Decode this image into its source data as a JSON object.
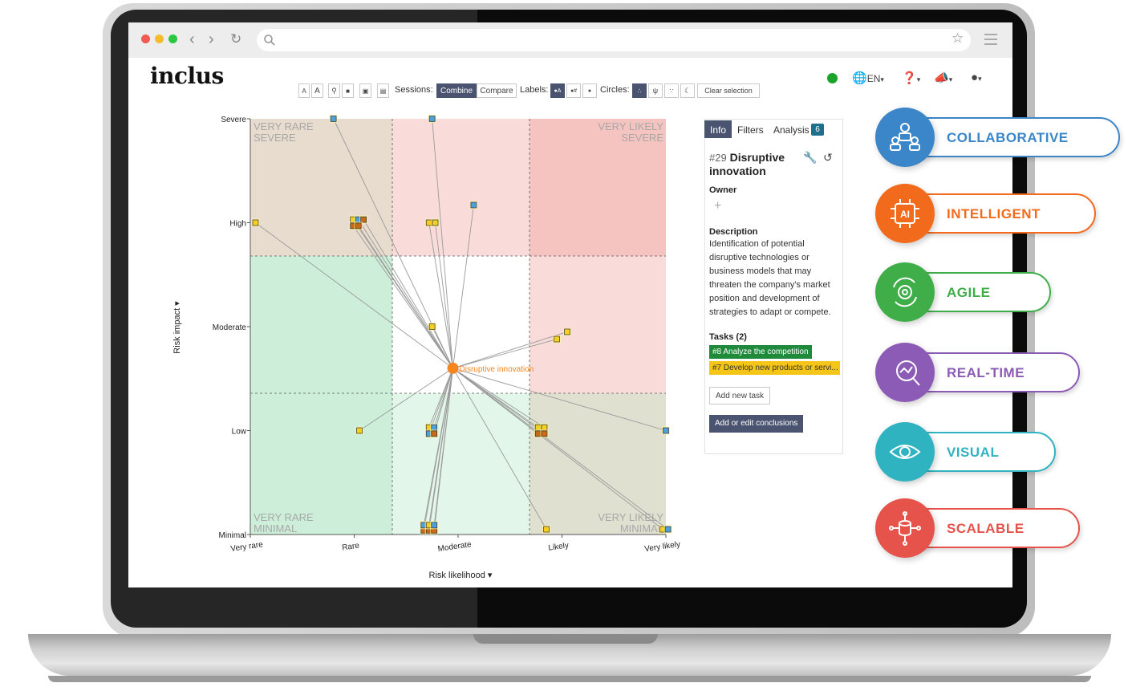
{
  "browser": {
    "url": ""
  },
  "app": {
    "logo": "inclus"
  },
  "toolbar": {
    "font_small": "A",
    "font_large": "A",
    "sessions_label": "Sessions:",
    "combine_label": "Combine",
    "compare_label": "Compare",
    "labels_label": "Labels:",
    "circles_label": "Circles:",
    "clear_selection_label": "Clear selection"
  },
  "header": {
    "language": "EN",
    "status_color": "#1aa32a"
  },
  "chart": {
    "quadrant_labels": {
      "top_left": [
        "VERY RARE",
        "SEVERE"
      ],
      "top_right": [
        "VERY LIKELY",
        "SEVERE"
      ],
      "bottom_left": [
        "VERY RARE",
        "MINIMAL"
      ],
      "bottom_right": [
        "VERY LIKELY",
        "MINIMAL"
      ]
    },
    "zone_colors": {
      "brown": "#e8dccf",
      "pink": "#f9dcd9",
      "red": "#f6c4c0",
      "white": "#ffffff",
      "green_dark": "#cdeed9",
      "green_light": "#e2f6e9",
      "olive": "#e0e0d1"
    },
    "center_label": "Disruptive innovation",
    "center_color": "#f5861f"
  },
  "chart_data": {
    "type": "scatter",
    "xlabel": "Risk likelihood",
    "ylabel": "Risk impact",
    "x_ticks": [
      "Very rare",
      "Rare",
      "Moderate",
      "Likely",
      "Very likely"
    ],
    "y_ticks": [
      "Minimal",
      "Low",
      "Moderate",
      "High",
      "Severe"
    ],
    "xlim": [
      1,
      5
    ],
    "ylim": [
      1,
      5
    ],
    "center": {
      "name": "Disruptive innovation",
      "x": 2.95,
      "y": 2.6
    },
    "points": [
      {
        "x": 1.8,
        "y": 5.0,
        "c": "#4f9fd8"
      },
      {
        "x": 2.75,
        "y": 5.0,
        "c": "#4f9fd8"
      },
      {
        "x": 1.05,
        "y": 4.0,
        "c": "#f5d020"
      },
      {
        "x": 1.99,
        "y": 4.03,
        "c": "#f5d020"
      },
      {
        "x": 2.04,
        "y": 4.03,
        "c": "#4f9fd8"
      },
      {
        "x": 2.09,
        "y": 4.03,
        "c": "#c86a14"
      },
      {
        "x": 1.99,
        "y": 3.97,
        "c": "#c86a14"
      },
      {
        "x": 2.04,
        "y": 3.97,
        "c": "#c86a14"
      },
      {
        "x": 2.72,
        "y": 4.0,
        "c": "#f5d020"
      },
      {
        "x": 2.78,
        "y": 4.0,
        "c": "#f5d020"
      },
      {
        "x": 3.15,
        "y": 4.17,
        "c": "#4f9fd8"
      },
      {
        "x": 3.95,
        "y": 2.88,
        "c": "#f5d020"
      },
      {
        "x": 4.05,
        "y": 2.95,
        "c": "#f5d020"
      },
      {
        "x": 2.75,
        "y": 3.0,
        "c": "#f5d020"
      },
      {
        "x": 2.05,
        "y": 2.0,
        "c": "#f5d020"
      },
      {
        "x": 2.72,
        "y": 2.03,
        "c": "#f5d020"
      },
      {
        "x": 2.77,
        "y": 2.03,
        "c": "#4f9fd8"
      },
      {
        "x": 2.72,
        "y": 1.97,
        "c": "#4f9fd8"
      },
      {
        "x": 2.77,
        "y": 1.97,
        "c": "#c86a14"
      },
      {
        "x": 3.77,
        "y": 2.03,
        "c": "#f5d020"
      },
      {
        "x": 3.83,
        "y": 2.03,
        "c": "#f5d020"
      },
      {
        "x": 3.77,
        "y": 1.97,
        "c": "#c86a14"
      },
      {
        "x": 3.83,
        "y": 1.97,
        "c": "#c86a14"
      },
      {
        "x": 5.0,
        "y": 2.0,
        "c": "#4f9fd8"
      },
      {
        "x": 2.67,
        "y": 1.04,
        "c": "#c86a14"
      },
      {
        "x": 2.72,
        "y": 1.04,
        "c": "#c86a14"
      },
      {
        "x": 2.77,
        "y": 1.04,
        "c": "#c86a14"
      },
      {
        "x": 2.67,
        "y": 1.09,
        "c": "#4f9fd8"
      },
      {
        "x": 2.72,
        "y": 1.09,
        "c": "#f5d020"
      },
      {
        "x": 2.77,
        "y": 1.09,
        "c": "#4f9fd8"
      },
      {
        "x": 3.85,
        "y": 1.05,
        "c": "#f5d020"
      },
      {
        "x": 4.97,
        "y": 1.05,
        "c": "#f5d020"
      },
      {
        "x": 5.02,
        "y": 1.05,
        "c": "#4f9fd8"
      }
    ]
  },
  "panel": {
    "tabs": {
      "info": "Info",
      "filters": "Filters",
      "analysis": "Analysis",
      "analysis_count": "6"
    },
    "risk_id": "#29",
    "risk_title": "Disruptive innovation",
    "owner_label": "Owner",
    "owner_add": "+",
    "description_label": "Description",
    "description": "Identification of potential disruptive technologies or business models that may threaten the company's market position and development of strategies to adapt or compete.",
    "tasks_label": "Tasks (2)",
    "tasks": [
      {
        "label": "#8 Analyze the competition",
        "color": "#1f8a3a"
      },
      {
        "label": "#7 Develop new products or servi...",
        "color": "#f5c518"
      }
    ],
    "add_task": "Add new task",
    "add_conclusions": "Add or edit conclusions"
  },
  "features": [
    {
      "label": "COLLABORATIVE",
      "color": "#3a86c8",
      "text_color": "#3a86c8"
    },
    {
      "label": "INTELLIGENT",
      "color": "#f26b1d",
      "text_color": "#f26b1d"
    },
    {
      "label": "AGILE",
      "color": "#3fae49",
      "text_color": "#3fae49"
    },
    {
      "label": "REAL-TIME",
      "color": "#8c5bb5",
      "text_color": "#8c5bb5"
    },
    {
      "label": "VISUAL",
      "color": "#2fb3c0",
      "text_color": "#2fb3c0"
    },
    {
      "label": "SCALABLE",
      "color": "#e5534b",
      "text_color": "#e5534b"
    }
  ]
}
